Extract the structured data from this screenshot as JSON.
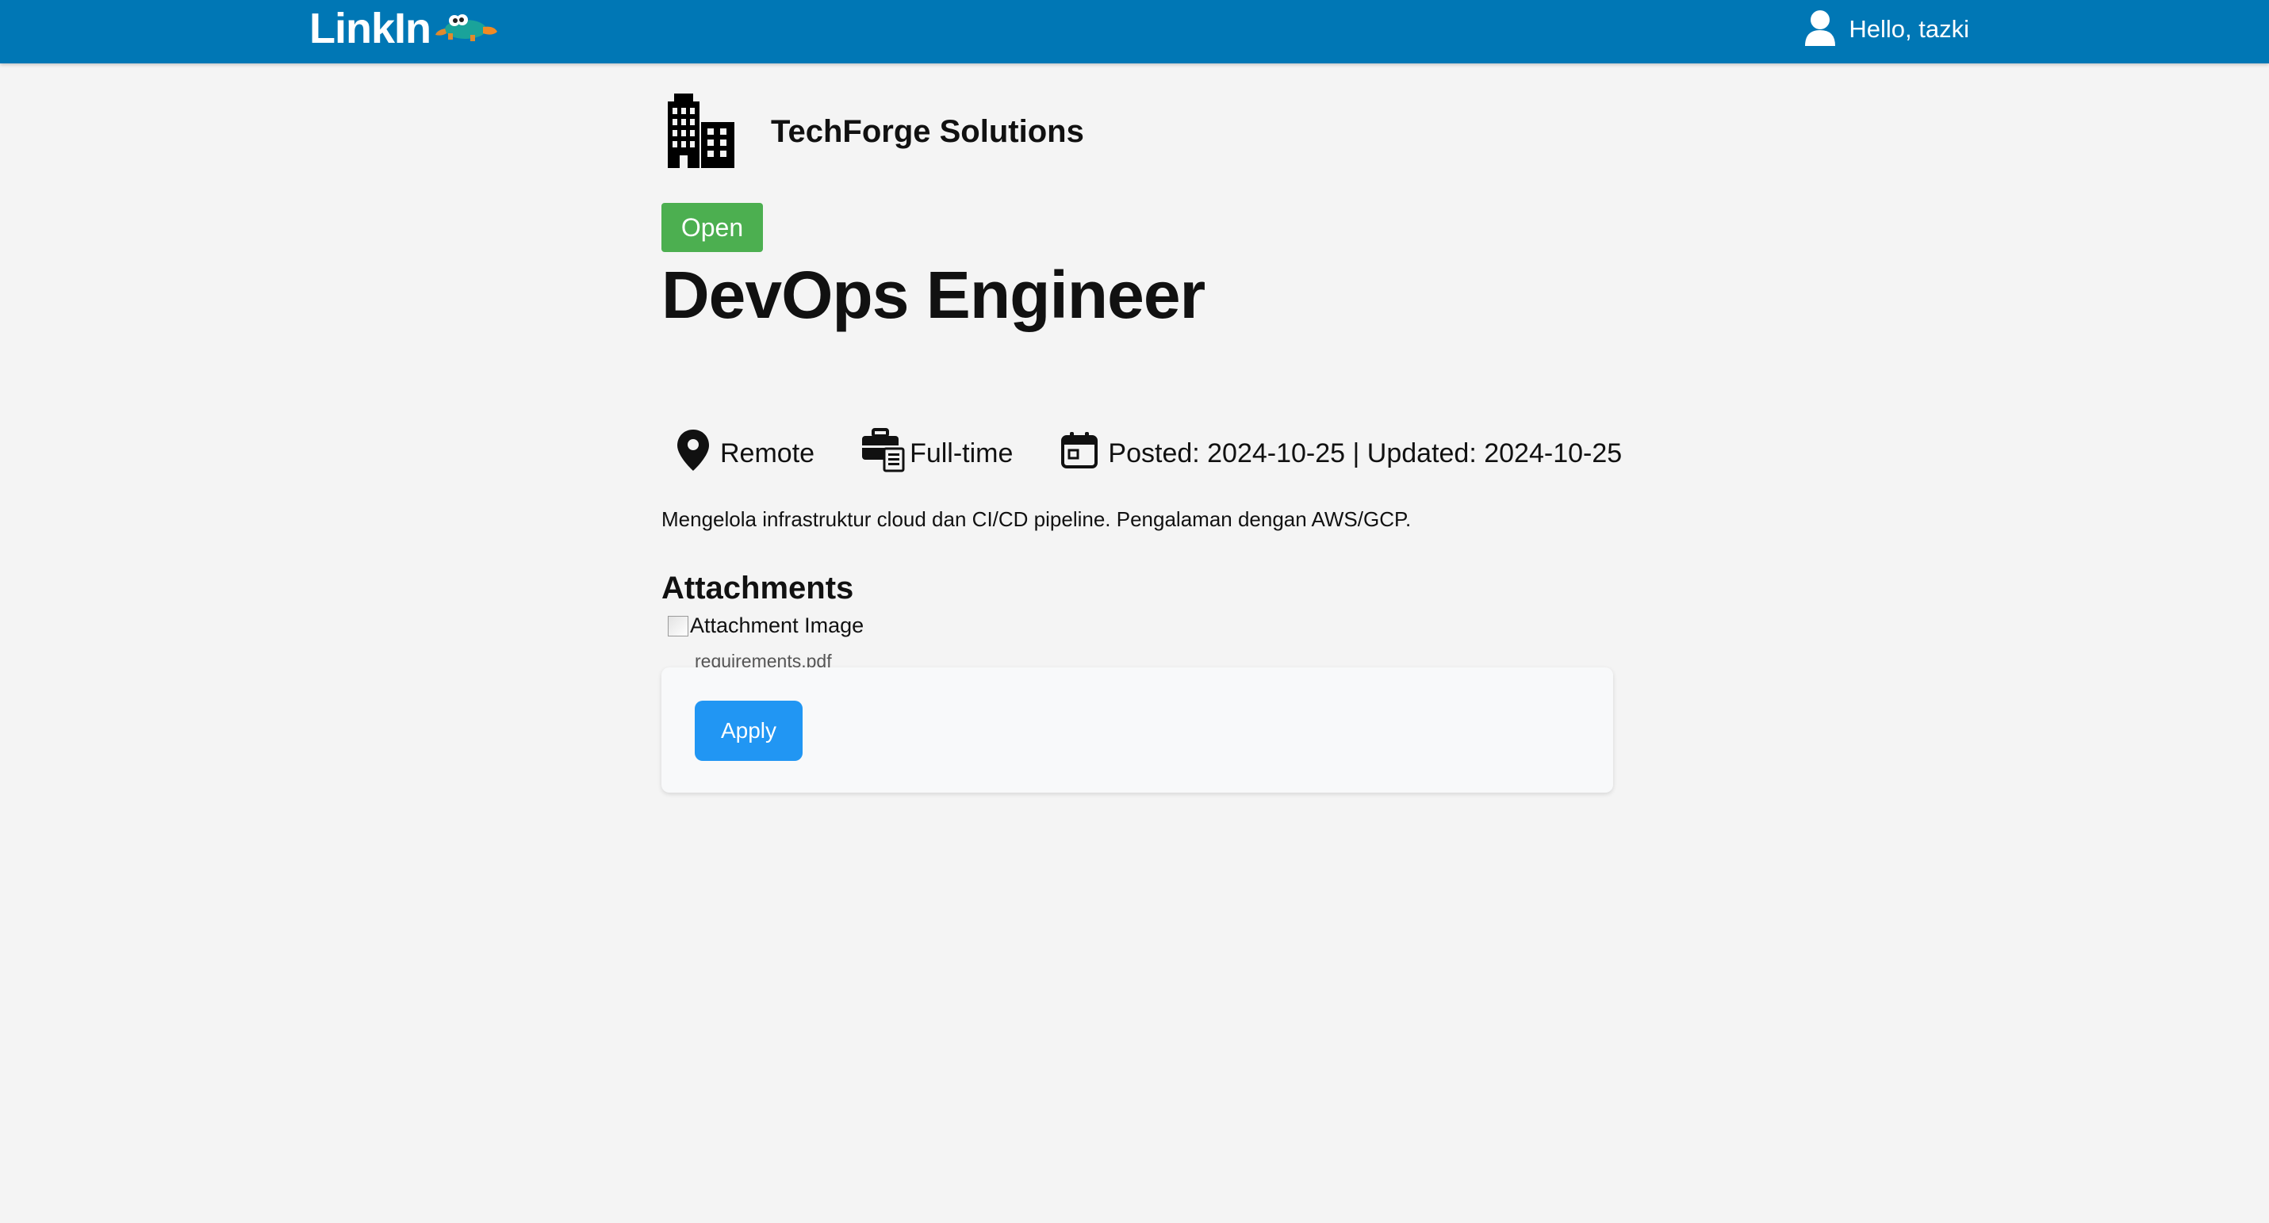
{
  "header": {
    "brand": "LinkIn",
    "mascot_icon": "platypus-icon",
    "user_icon": "user-icon",
    "greeting": "Hello, tazki"
  },
  "company": {
    "icon": "building-icon",
    "name": "TechForge Solutions"
  },
  "job": {
    "status": "Open",
    "status_color": "#4caf50",
    "title": "DevOps Engineer",
    "location": "Remote",
    "location_icon": "map-pin-icon",
    "type": "Full-time",
    "type_icon": "briefcase-icon",
    "dates": "Posted: 2024-10-25 | Updated: 2024-10-25",
    "date_icon": "calendar-icon",
    "description": "Mengelola infrastruktur cloud dan CI/CD pipeline. Pengalaman dengan AWS/GCP."
  },
  "attachments": {
    "heading": "Attachments",
    "items": [
      {
        "alt": "Attachment Image",
        "filename": "requirements.pdf"
      }
    ]
  },
  "apply": {
    "label": "Apply"
  },
  "colors": {
    "navbar": "#0077b5",
    "background": "#f4f4f4",
    "apply_button": "#2196f3"
  }
}
